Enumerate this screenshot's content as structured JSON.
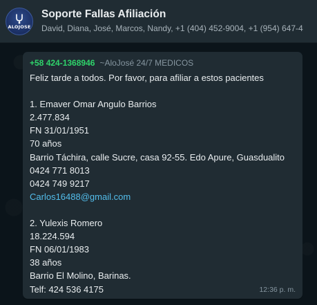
{
  "header": {
    "avatar_text": "ALOJOSE",
    "title": "Soporte Fallas Afiliación",
    "subtitle": "David, Diana, José, Marcos, Nandy, +1 (404) 452-9004, +1 (954) 647-4"
  },
  "message": {
    "sender_phone": "+58 424-1368946",
    "sender_name": "~AloJosé 24/7 MEDICOS",
    "greeting": "Feliz tarde a todos. Por favor, para afiliar a estos pacientes",
    "patient1": {
      "name": "1. Emaver Omar Angulo Barrios",
      "id": "2.477.834",
      "birth": "FN 31/01/1951",
      "age": "70 años",
      "address": "Barrio Táchira, calle Sucre, casa 92-55. Edo Apure, Guasdualito",
      "phone1": "0424 771 8013",
      "phone2": "0424 749 9217",
      "email": "Carlos16488@gmail.com"
    },
    "patient2": {
      "name": "2. Yulexis Romero",
      "id": "18.224.594",
      "birth": "FN 06/01/1983",
      "age": "38 años",
      "address": "Barrio El Molino, Barinas.",
      "phone": "Telf: 424 536 4175"
    },
    "time": "12:36 p. m."
  },
  "colors": {
    "app_background": "#0b141a",
    "panel": "#202c33",
    "sender_phone": "#2fd46b",
    "link": "#53bdeb",
    "primary_text": "#e9edef",
    "secondary_text": "#8696a0"
  }
}
